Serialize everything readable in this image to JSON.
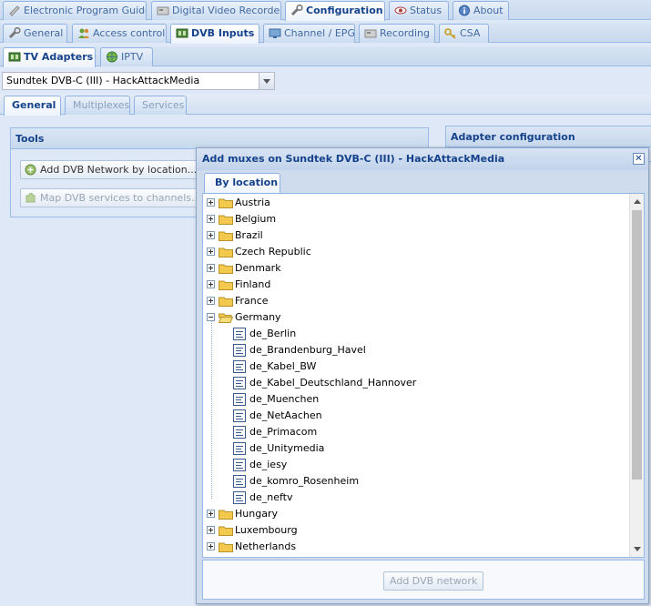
{
  "main_tabs": [
    {
      "label": "Electronic Program Guide",
      "icon": "tv-guide-icon"
    },
    {
      "label": "Digital Video Recorder",
      "icon": "recorder-icon"
    },
    {
      "label": "Configuration",
      "icon": "wrench-icon",
      "active": true
    },
    {
      "label": "Status",
      "icon": "eye-icon"
    },
    {
      "label": "About",
      "icon": "info-icon"
    }
  ],
  "config_tabs": [
    {
      "label": "General",
      "icon": "wrench-icon"
    },
    {
      "label": "Access control",
      "icon": "users-icon"
    },
    {
      "label": "DVB Inputs",
      "icon": "tuner-icon",
      "active": true
    },
    {
      "label": "Channel / EPG",
      "icon": "tv-icon"
    },
    {
      "label": "Recording",
      "icon": "recorder-icon"
    },
    {
      "label": "CSA",
      "icon": "key-icon"
    }
  ],
  "input_tabs": [
    {
      "label": "TV Adapters",
      "icon": "tuner-icon",
      "active": true
    },
    {
      "label": "IPTV",
      "icon": "globe-icon"
    }
  ],
  "adapter_select": {
    "value": "Sundtek DVB-C (III) - HackAttackMedia"
  },
  "adapter_tabs": [
    {
      "label": "General",
      "active": true
    },
    {
      "label": "Multiplexes"
    },
    {
      "label": "Services"
    }
  ],
  "tools_panel": {
    "title": "Tools",
    "add_network_label": "Add DVB Network by location...",
    "map_services_label": "Map DVB services to channels..."
  },
  "adapter_config_panel": {
    "title": "Adapter configuration"
  },
  "dialog": {
    "title": "Add muxes on Sundtek DVB-C (III) - HackAttackMedia",
    "tab_label": "By location",
    "countries_before": [
      "Austria",
      "Belgium",
      "Brazil",
      "Czech Republic",
      "Denmark",
      "Finland",
      "France"
    ],
    "expanded_country": "Germany",
    "networks": [
      "de_Berlin",
      "de_Brandenburg_Havel",
      "de_Kabel_BW",
      "de_Kabel_Deutschland_Hannover",
      "de_Muenchen",
      "de_NetAachen",
      "de_Primacom",
      "de_Unitymedia",
      "de_iesy",
      "de_komro_Rosenheim",
      "de_neftv"
    ],
    "countries_after": [
      "Hungary",
      "Luxembourg",
      "Netherlands"
    ],
    "add_button_label": "Add DVB network"
  },
  "colors": {
    "header_text": "#15428b",
    "panel_bg": "#dfe8f6",
    "border": "#99bbe8",
    "folder": "#f2c94c"
  }
}
